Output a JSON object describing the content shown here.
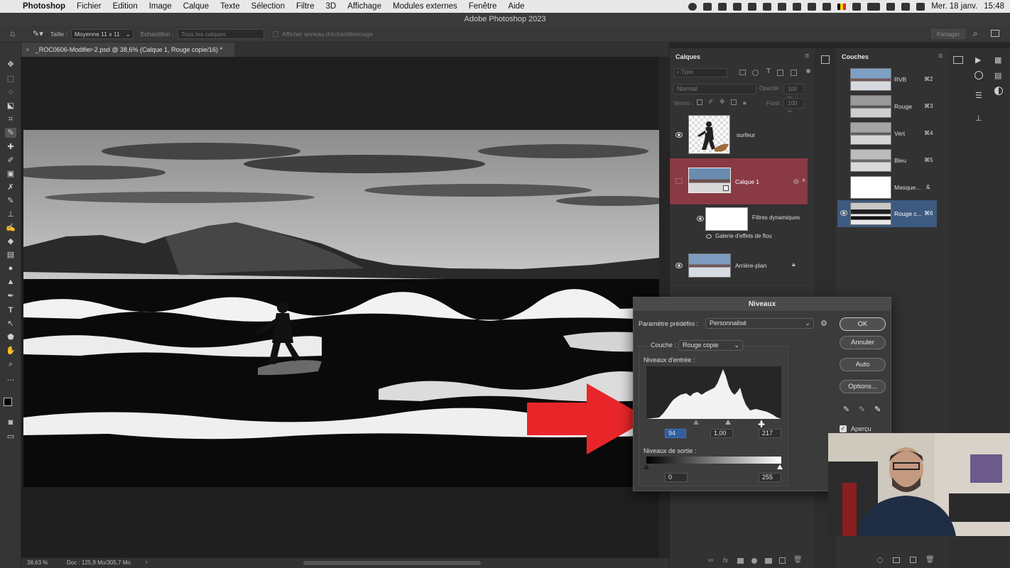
{
  "menubar": {
    "apple": "",
    "app": "Photoshop",
    "items": [
      "Fichier",
      "Edition",
      "Image",
      "Calque",
      "Texte",
      "Sélection",
      "Filtre",
      "3D",
      "Affichage",
      "Modules externes",
      "Fenêtre",
      "Aide"
    ],
    "date": "Mer. 18 janv.",
    "time": "15:48"
  },
  "window_title": "Adobe Photoshop 2023",
  "options_bar": {
    "size_label": "Taille :",
    "size_value": "Moyenne 11 x 11",
    "sample_label": "Echantillon :",
    "sample_value": "Tous les calques",
    "ring_label": "Afficher anneau d'échantillonnage",
    "share": "Partager"
  },
  "document": {
    "tab_title": "_ROC0606-Modifier-2.psd @ 38,6% (Calque 1, Rouge copie/16) *",
    "zoom": "38,63 %",
    "doc_info": "Doc : 125,9 Mo/305,7 Mo"
  },
  "layers_panel": {
    "title": "Calques",
    "filter_placeholder": "Type",
    "blend_mode": "Normal",
    "opacity_label": "Opacité :",
    "opacity_value": "100 %",
    "lock_label": "Verrou :",
    "fill_label": "Fond :",
    "fill_value": "100 %",
    "layers": [
      {
        "name": "surfeur",
        "visible": true
      },
      {
        "name": "Calque 1",
        "visible": false,
        "selected": true
      },
      {
        "name": "Filtres dynamiques",
        "visible": true
      },
      {
        "name": "Galerie d'effets de flou"
      },
      {
        "name": "Arrière-plan",
        "visible": true,
        "locked": true
      }
    ]
  },
  "channels_panel": {
    "title": "Couches",
    "channels": [
      {
        "name": "RVB",
        "shortcut": "⌘2"
      },
      {
        "name": "Rouge",
        "shortcut": "⌘3"
      },
      {
        "name": "Vert",
        "shortcut": "⌘4"
      },
      {
        "name": "Bleu",
        "shortcut": "⌘5"
      },
      {
        "name": "Masque...",
        "shortcut": "&"
      },
      {
        "name": "Rouge c...",
        "shortcut": "⌘6",
        "selected": true
      }
    ]
  },
  "levels_dialog": {
    "title": "Niveaux",
    "preset_label": "Paramètre prédéfini :",
    "preset_value": "Personnalisé",
    "channel_label": "Couche :",
    "channel_value": "Rouge copie",
    "input_label": "Niveaux d'entrée :",
    "input_black": "94",
    "input_gamma": "1,00",
    "input_white": "217",
    "output_label": "Niveaux de sortie :",
    "output_black": "0",
    "output_white": "255",
    "buttons": {
      "ok": "OK",
      "cancel": "Annuler",
      "auto": "Auto",
      "options": "Options..."
    },
    "preview_label": "Aperçu",
    "preview_checked": true
  },
  "colors": {
    "selected_layer": "#8a3a44",
    "selected_channel": "#3d5a80",
    "arrow": "#e8262a"
  }
}
